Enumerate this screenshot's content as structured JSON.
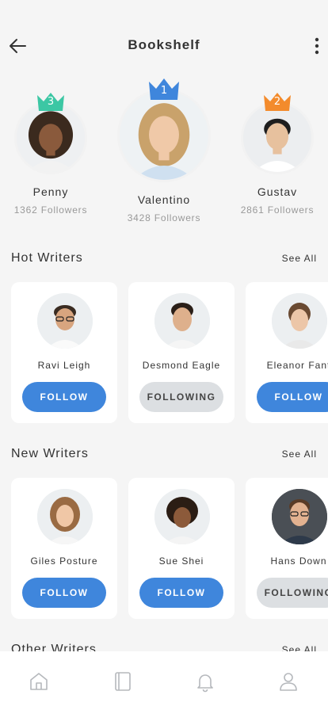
{
  "header": {
    "title": "Bookshelf"
  },
  "podium": [
    {
      "rank": "3",
      "name": "Penny",
      "followers": "1362 Followers",
      "crown_color": "#3cc7a4"
    },
    {
      "rank": "1",
      "name": "Valentino",
      "followers": "3428 Followers",
      "crown_color": "#3f86dc"
    },
    {
      "rank": "2",
      "name": "Gustav",
      "followers": "2861 Followers",
      "crown_color": "#f38b2c"
    }
  ],
  "hot_writers": {
    "title": "Hot Writers",
    "see_all": "See All",
    "items": [
      {
        "name": "Ravi Leigh",
        "button": "FOLLOW"
      },
      {
        "name": "Desmond Eagle",
        "button": "FOLLOWING"
      },
      {
        "name": "Eleanor Fant",
        "button": "FOLLOW"
      }
    ]
  },
  "new_writers": {
    "title": "New Writers",
    "see_all": "See All",
    "items": [
      {
        "name": "Giles Posture",
        "button": "FOLLOW"
      },
      {
        "name": "Sue Shei",
        "button": "FOLLOW"
      },
      {
        "name": "Hans Down",
        "button": "FOLLOWING"
      }
    ]
  },
  "other_writers": {
    "title": "Other Writers",
    "see_all": "See All"
  },
  "bottom_nav": [
    "home-icon",
    "book-icon",
    "bell-icon",
    "user-icon"
  ],
  "colors": {
    "accent": "#3f86dc",
    "following_bg": "#dcdfe2"
  }
}
